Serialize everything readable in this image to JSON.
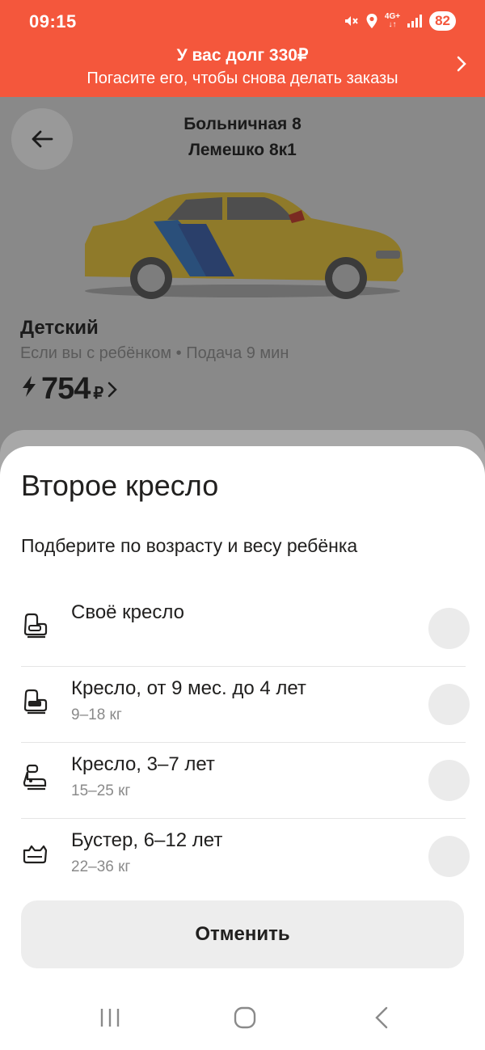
{
  "status_bar": {
    "time": "09:15",
    "network_top": "4G+",
    "battery": "82",
    "icons": [
      "mute-icon",
      "location-icon",
      "signal-icon"
    ]
  },
  "debt_banner": {
    "title": "У вас долг 330₽",
    "subtitle": "Погасите его, чтобы снова делать заказы",
    "bg_color": "#f4573c"
  },
  "route": {
    "from": "Больничная 8",
    "to": "Лемешко 8к1"
  },
  "tariff": {
    "name": "Детский",
    "description": "Если вы с ребёнком • Подача 9 мин",
    "price": "754",
    "currency": "₽"
  },
  "sheet": {
    "title": "Второе кресло",
    "subtitle": "Подберите по возрасту и весу ребёнка",
    "options": [
      {
        "label": "Своё кресло",
        "weight": "",
        "icon": "own-seat-icon"
      },
      {
        "label": "Кресло, от 9 мес. до 4 лет",
        "weight": "9–18 кг",
        "icon": "infant-seat-icon"
      },
      {
        "label": "Кресло, 3–7 лет",
        "weight": "15–25 кг",
        "icon": "child-seat-icon"
      },
      {
        "label": "Бустер, 6–12 лет",
        "weight": "22–36 кг",
        "icon": "booster-icon"
      }
    ],
    "cancel_label": "Отменить"
  },
  "nav_bar": {
    "buttons": [
      "recents-icon",
      "home-icon",
      "back-icon"
    ]
  }
}
